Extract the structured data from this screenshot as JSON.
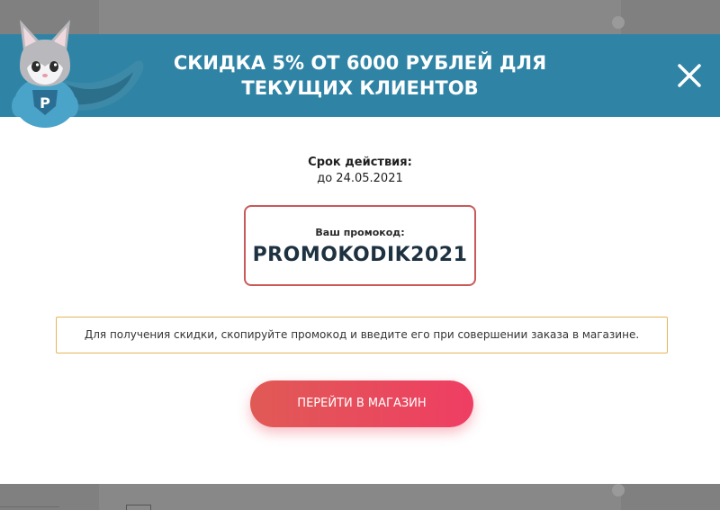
{
  "header": {
    "title_line1": "СКИДКА 5% ОТ 6000 РУБЛЕЙ ДЛЯ",
    "title_line2": "ТЕКУЩИХ КЛИЕНТОВ",
    "close_icon": "close-icon",
    "mascot_icon": "fox-superhero-mascot"
  },
  "validity": {
    "label": "Срок действия:",
    "value": "до 24.05.2021"
  },
  "promo": {
    "label": "Ваш промокод:",
    "code": "PROMOKODIK2021"
  },
  "info": {
    "text": "Для получения скидки, скопируйте промокод и введите его при совершении заказа в магазине."
  },
  "cta": {
    "label": "ПЕРЕЙТИ В МАГАЗИН"
  },
  "colors": {
    "header_bg": "#2f84a6",
    "promo_border": "#c95a5a",
    "info_border": "#e5b65a",
    "button_start": "#e05a55",
    "button_end": "#ef3e63"
  }
}
